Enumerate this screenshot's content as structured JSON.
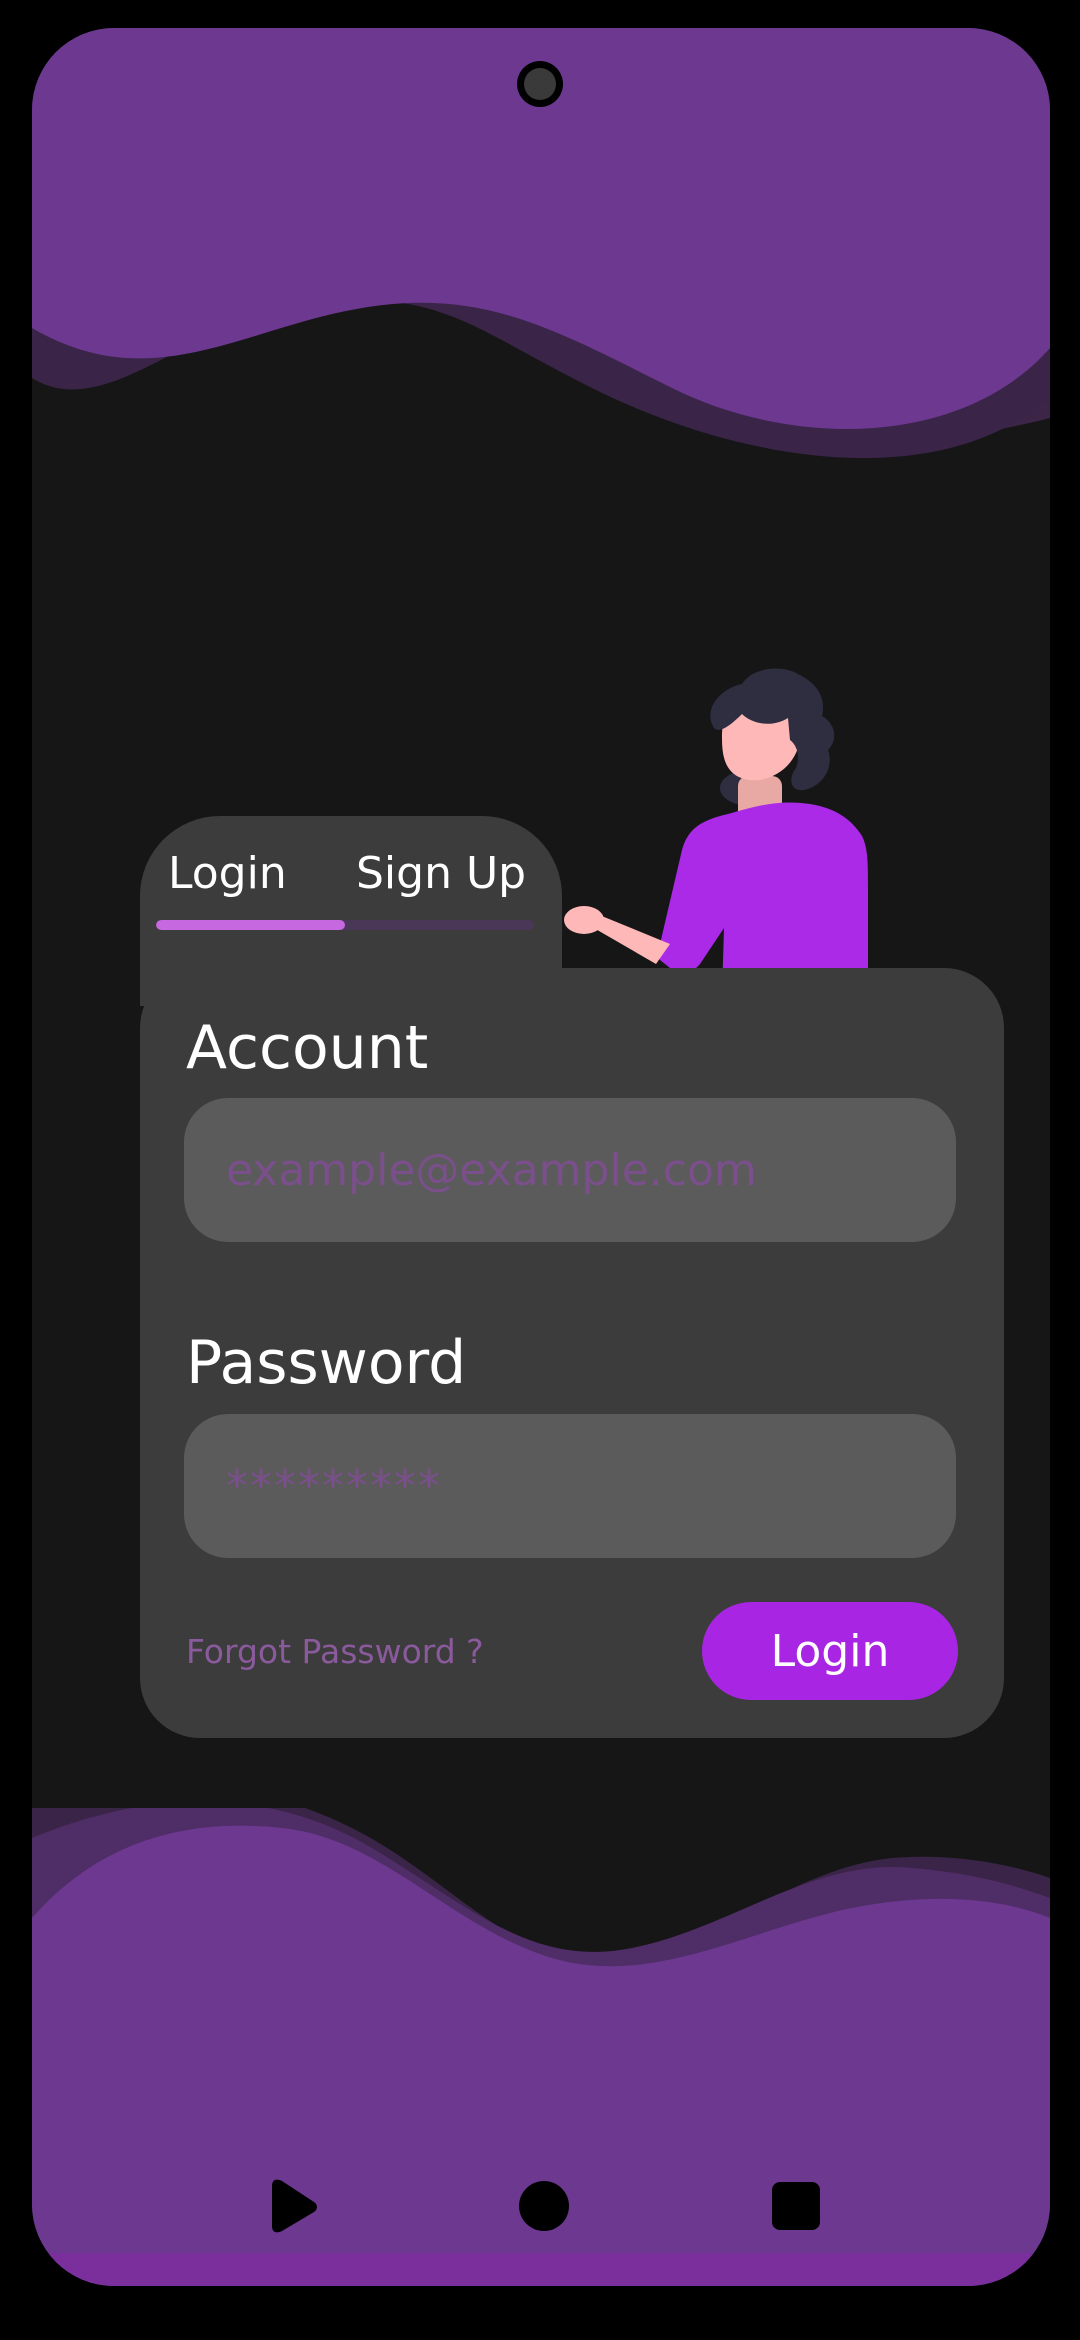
{
  "tabs": {
    "login_label": "Login",
    "signup_label": "Sign Up",
    "active": "login",
    "active_fraction": 0.5
  },
  "form": {
    "account_label": "Account",
    "account_placeholder": "example@example.com",
    "password_label": "Password",
    "password_placeholder": "*********",
    "forgot_label": "Forgot Password ?",
    "login_button": "Login"
  },
  "navbar": {
    "back_icon": "play-triangle-icon",
    "home_icon": "circle-icon",
    "recents_icon": "square-icon"
  },
  "colors": {
    "accent": "#a826e3",
    "wave": "#6c3890",
    "background": "#161616",
    "card": "#3c3c3c",
    "input": "#5b5b5b",
    "placeholder": "#7a4f8c"
  }
}
